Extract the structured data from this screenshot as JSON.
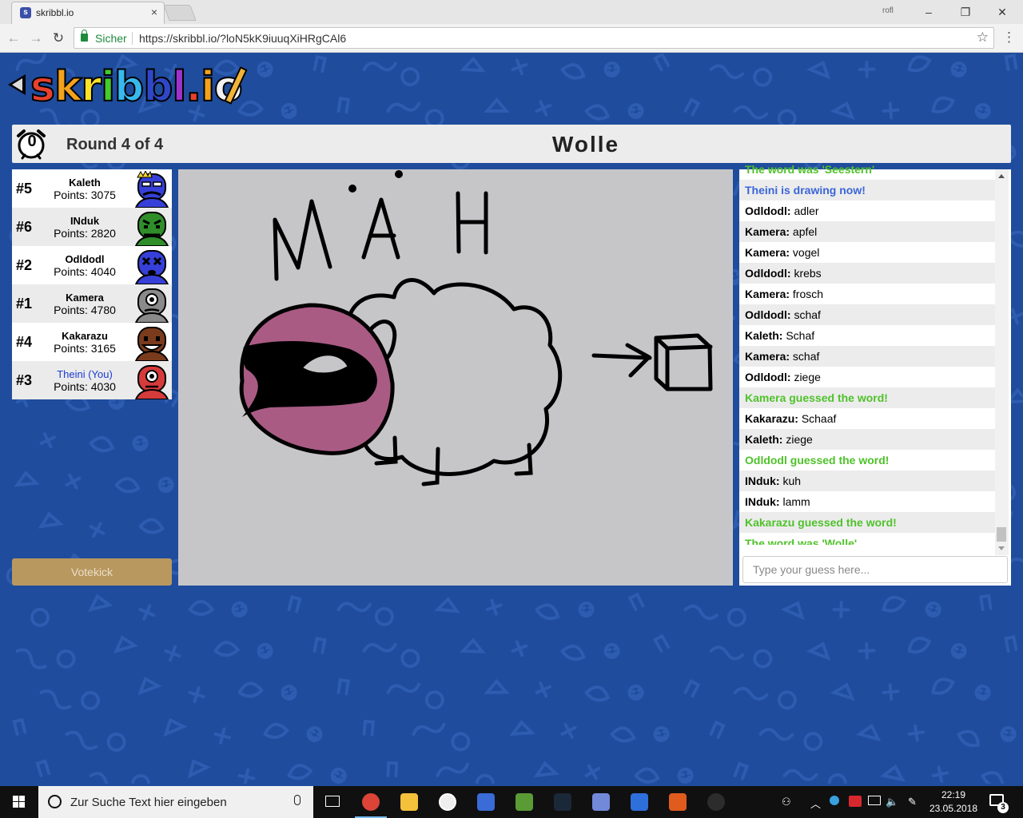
{
  "browser": {
    "tab_title": "skribbl.io",
    "favicon_letter": "s",
    "tab_close": "×",
    "profile_label": "rofl",
    "window_controls": {
      "minimize": "–",
      "maximize": "❐",
      "close": "✕"
    },
    "nav": {
      "back": "←",
      "forward": "→",
      "reload": "↻"
    },
    "secure_label": "Sicher",
    "url": "https://skribbl.io/?loN5kK9iuuqXiHRgCAl6",
    "star_icon": "☆",
    "menu_icon": "⋮"
  },
  "logo": {
    "letters": [
      {
        "char": "s",
        "color": "#e8412d"
      },
      {
        "char": "k",
        "color": "#f4a21d"
      },
      {
        "char": "r",
        "color": "#fde326"
      },
      {
        "char": "i",
        "color": "#44cc2e"
      },
      {
        "char": "b",
        "color": "#38b9ee"
      },
      {
        "char": "b",
        "color": "#2f47c7"
      },
      {
        "char": "l",
        "color": "#a032cc"
      },
      {
        "char": ".",
        "color": "#e8412d"
      },
      {
        "char": "i",
        "color": "#f4a21d"
      },
      {
        "char": "o",
        "color": "#f2f2f2"
      }
    ]
  },
  "game": {
    "timer": "0",
    "round_label": "Round 4 of 4",
    "word": "Wolle"
  },
  "players": [
    {
      "rank": "#5",
      "name": "Kaleth",
      "points": "Points: 3075",
      "you": false,
      "avatar_color": "#3640d8",
      "crown": true,
      "face": "mustache"
    },
    {
      "rank": "#6",
      "name": "INduk",
      "points": "Points: 2820",
      "you": false,
      "avatar_color": "#2f8e2a",
      "crown": false,
      "face": "angry"
    },
    {
      "rank": "#2",
      "name": "Odldodl",
      "points": "Points: 4040",
      "you": false,
      "avatar_color": "#3640d8",
      "crown": false,
      "face": "dead"
    },
    {
      "rank": "#1",
      "name": "Kamera",
      "points": "Points: 4780",
      "you": false,
      "avatar_color": "#8a8a8a",
      "crown": false,
      "face": "cyclops"
    },
    {
      "rank": "#4",
      "name": "Kakarazu",
      "points": "Points: 3165",
      "you": false,
      "avatar_color": "#7a3b1d",
      "crown": false,
      "face": "smile"
    },
    {
      "rank": "#3",
      "name": "Theini (You)",
      "points": "Points: 4030",
      "you": true,
      "avatar_color": "#d63b3b",
      "crown": false,
      "face": "cyclops-red"
    }
  ],
  "votekick_label": "Votekick",
  "drawing": {
    "caption": "MÄH"
  },
  "chat": {
    "messages": [
      {
        "type": "green",
        "text": "The word was 'Seestern'"
      },
      {
        "type": "blue",
        "text": "Theini is drawing now!"
      },
      {
        "type": "guess",
        "user": "Odldodl:",
        "text": "adler"
      },
      {
        "type": "guess",
        "user": "Kamera:",
        "text": "apfel"
      },
      {
        "type": "guess",
        "user": "Kamera:",
        "text": "vogel"
      },
      {
        "type": "guess",
        "user": "Odldodl:",
        "text": "krebs"
      },
      {
        "type": "guess",
        "user": "Kamera:",
        "text": "frosch"
      },
      {
        "type": "guess",
        "user": "Odldodl:",
        "text": "schaf"
      },
      {
        "type": "guess",
        "user": "Kaleth:",
        "text": "Schaf"
      },
      {
        "type": "guess",
        "user": "Kamera:",
        "text": "schaf"
      },
      {
        "type": "guess",
        "user": "Odldodl:",
        "text": "ziege"
      },
      {
        "type": "green",
        "text": "Kamera guessed the word!"
      },
      {
        "type": "guess",
        "user": "Kakarazu:",
        "text": "Schaaf"
      },
      {
        "type": "guess",
        "user": "Kaleth:",
        "text": "ziege"
      },
      {
        "type": "green",
        "text": "Odldodl guessed the word!"
      },
      {
        "type": "guess",
        "user": "INduk:",
        "text": "kuh"
      },
      {
        "type": "guess",
        "user": "INduk:",
        "text": "lamm"
      },
      {
        "type": "green",
        "text": "Kakarazu guessed the word!"
      },
      {
        "type": "green",
        "text": "The word was 'Wolle'"
      }
    ],
    "input_placeholder": "Type your guess here..."
  },
  "taskbar": {
    "search_placeholder": "Zur Suche Text hier eingeben",
    "apps": [
      "task-view-icon",
      "chrome-icon",
      "file-explorer-icon",
      "groove-icon",
      "paint-icon",
      "minecraft-icon",
      "steam-icon",
      "discord-icon",
      "rocket-league-icon",
      "game-icon",
      "obs-icon"
    ],
    "time": "22:19",
    "date": "23.05.2018",
    "notifications": "3",
    "tray": {
      "people": "⚇",
      "chevron": "︿",
      "volume": "🔈",
      "pen": "✎"
    }
  }
}
